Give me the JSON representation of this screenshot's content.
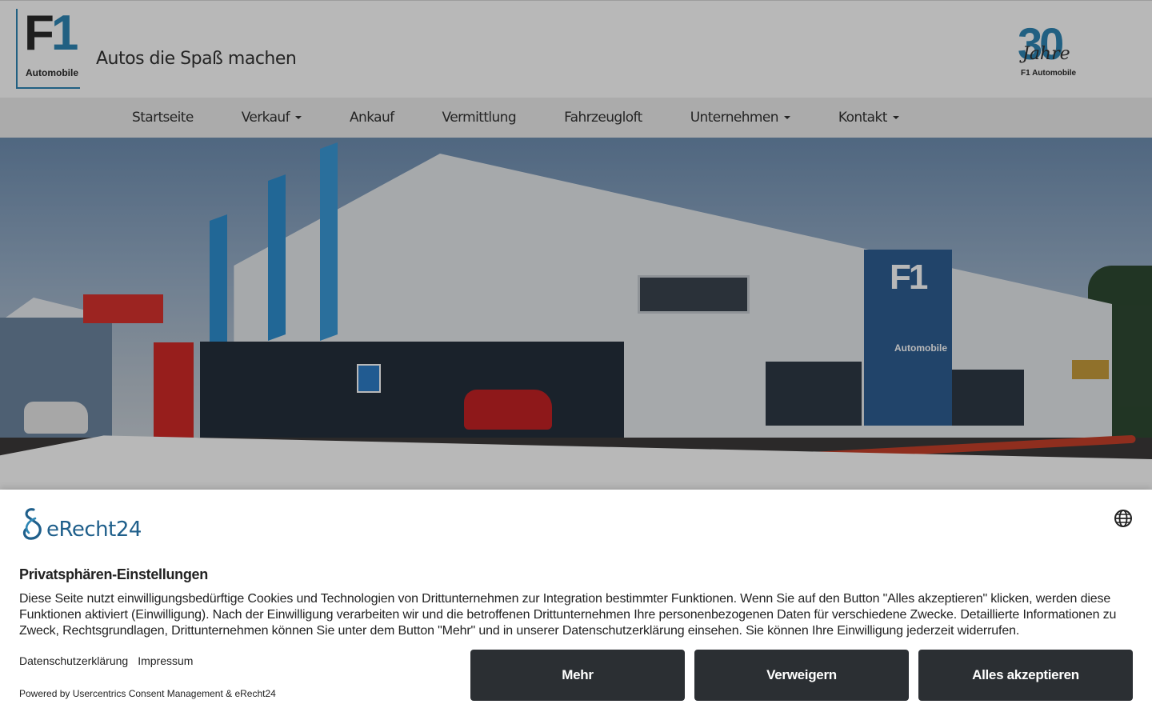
{
  "header": {
    "logo_text": "F1",
    "logo_sub": "Automobile",
    "tagline": "Autos die Spaß machen",
    "badge_number": "30",
    "badge_jahre": "Jahre",
    "badge_brand": "F1 Automobile",
    "accent_color": "#2e86b4"
  },
  "nav": {
    "items": [
      {
        "label": "Startseite",
        "dropdown": false
      },
      {
        "label": "Verkauf",
        "dropdown": true
      },
      {
        "label": "Ankauf",
        "dropdown": false
      },
      {
        "label": "Vermittlung",
        "dropdown": false
      },
      {
        "label": "Fahrzeugloft",
        "dropdown": false
      },
      {
        "label": "Unternehmen",
        "dropdown": true
      },
      {
        "label": "Kontakt",
        "dropdown": true
      }
    ]
  },
  "hero": {
    "sign_text": "F1",
    "sign_sub": "Automobile"
  },
  "consent": {
    "brand": "eRecht24",
    "title": "Privatsphären-Einstellungen",
    "text": "Diese Seite nutzt einwilligungsbedürftige Cookies und Technologien von Drittunternehmen zur Integration bestimmter Funktionen. Wenn Sie auf den Button \"Alles akzeptieren\" klicken, werden diese Funktionen aktiviert (Einwilligung). Nach der Einwilligung verarbeiten wir und die betroffenen Drittunternehmen Ihre personenbezogenen Daten für verschiedene Zwecke. Detaillierte Informationen zu Zweck, Rechtsgrundlagen, Drittunternehmen können Sie unter dem Button \"Mehr\" und in unserer Datenschutzerklärung einsehen. Sie können Ihre Einwilligung jederzeit widerrufen.",
    "links": [
      "Datenschutzerklärung",
      "Impressum"
    ],
    "powered_by": "Powered by Usercentrics Consent Management & eRecht24",
    "buttons": {
      "more": "Mehr",
      "deny": "Verweigern",
      "accept_all": "Alles akzeptieren"
    },
    "button_color": "#2b2f33",
    "brand_color": "#1f5f8b",
    "language_icon": "globe-icon"
  }
}
